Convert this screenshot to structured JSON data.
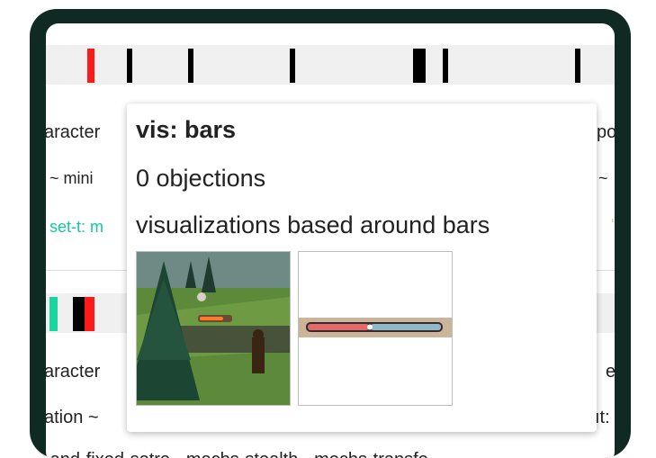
{
  "rows": {
    "row1": {
      "label_left": "aracter",
      "label_right": "po",
      "meta_left": "~  mini",
      "meta_right": "~",
      "tag_left": "set-t: m",
      "tag_right": "'"
    },
    "row2": {
      "label_left": "aracter",
      "label_right": "e",
      "meta_left": "ation  ~",
      "meta_right": "ıt:",
      "bottom_text": "-and-fixed-setre  ·   mechs-stealth   ·   mechs-transfo"
    }
  },
  "tooltip": {
    "title": "vis: bars",
    "objections": "0 objections",
    "description": "visualizations based around bars"
  },
  "colors": {
    "frame": "#0f2a22",
    "tick_black": "#000000",
    "tick_red": "#ff1a1a",
    "tick_teal": "#18d6a0",
    "tag_teal": "#18c6a0"
  },
  "thumbnails": [
    "game-scene-thumbnail",
    "health-bar-thumbnail"
  ]
}
